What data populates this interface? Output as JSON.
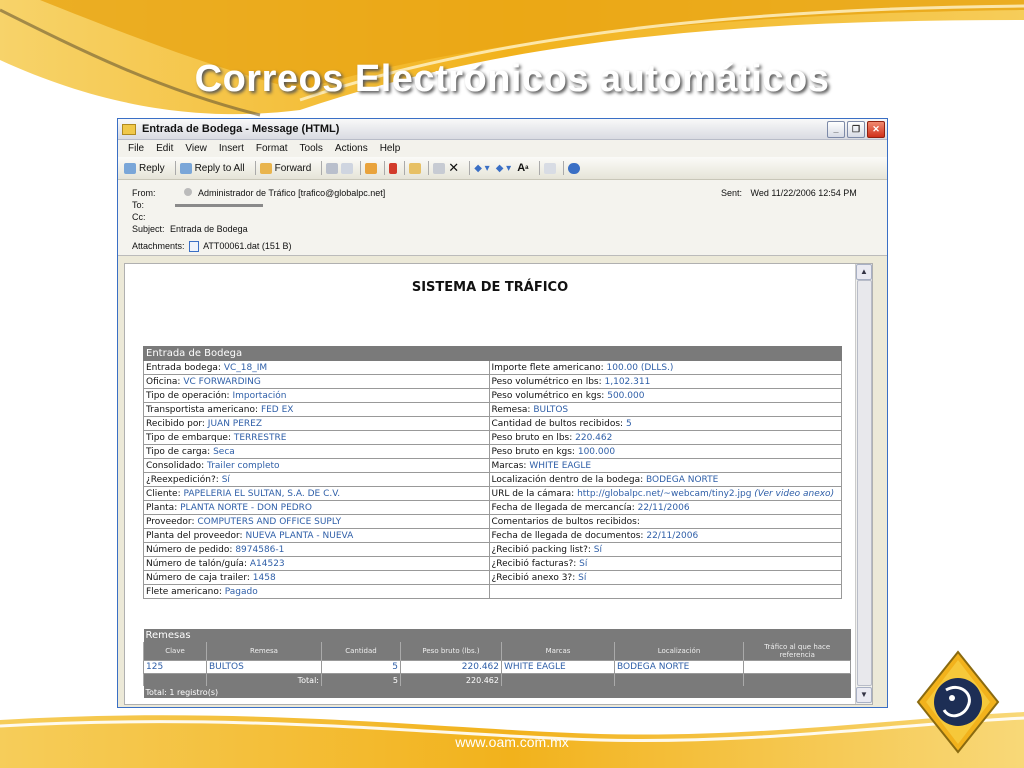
{
  "slide": {
    "title": "Correos Electrónicos automáticos",
    "footer_url": "www.oam.com.mx"
  },
  "window": {
    "title": "Entrada de Bodega - Message (HTML)",
    "menu": [
      "File",
      "Edit",
      "View",
      "Insert",
      "Format",
      "Tools",
      "Actions",
      "Help"
    ],
    "toolbar": {
      "reply": "Reply",
      "reply_all": "Reply to All",
      "forward": "Forward"
    }
  },
  "email": {
    "from_label": "From:",
    "from_value": "Administrador de Tráfico [trafico@globalpc.net]",
    "to_label": "To:",
    "cc_label": "Cc:",
    "subject_label": "Subject:",
    "subject_value": "Entrada de Bodega",
    "sent_label": "Sent:",
    "sent_value": "Wed 11/22/2006 12:54 PM",
    "attachments_label": "Attachments:",
    "attachment_value": "ATT00061.dat (151 B)"
  },
  "body": {
    "system_title": "SISTEMA DE TRÁFICO",
    "bodega_title": "Entrada de Bodega",
    "rows": [
      {
        "l_label": "Entrada bodega:",
        "l_value": "VC_18_IM",
        "r_label": "Importe flete americano:",
        "r_value": "100.00 (DLLS.)"
      },
      {
        "l_label": "Oficina:",
        "l_value": "VC FORWARDING",
        "r_label": "Peso volumétrico en lbs:",
        "r_value": "1,102.311"
      },
      {
        "l_label": "Tipo de operación:",
        "l_value": "Importación",
        "r_label": "Peso volumétrico en kgs:",
        "r_value": "500.000"
      },
      {
        "l_label": "Transportista americano:",
        "l_value": "FED EX",
        "r_label": "Remesa:",
        "r_value": "BULTOS"
      },
      {
        "l_label": "Recibido por:",
        "l_value": "JUAN PEREZ",
        "r_label": "Cantidad de bultos recibidos:",
        "r_value": "5"
      },
      {
        "l_label": "Tipo de embarque:",
        "l_value": "TERRESTRE",
        "r_label": "Peso bruto en lbs:",
        "r_value": "220.462"
      },
      {
        "l_label": "Tipo de carga:",
        "l_value": "Seca",
        "r_label": "Peso bruto en kgs:",
        "r_value": "100.000"
      },
      {
        "l_label": "Consolidado:",
        "l_value": "Trailer completo",
        "r_label": "Marcas:",
        "r_value": "WHITE EAGLE"
      },
      {
        "l_label": "¿Reexpedición?:",
        "l_value": "Sí",
        "r_label": "Localización dentro de la bodega:",
        "r_value": "BODEGA NORTE"
      },
      {
        "l_label": "Cliente:",
        "l_value": "PAPELERIA EL SULTAN, S.A. DE C.V.",
        "r_label": "URL de la cámara:",
        "r_value": "http://globalpc.net/~webcam/tiny2.jpg",
        "r_note": "(Ver video anexo)"
      },
      {
        "l_label": "Planta:",
        "l_value": "PLANTA NORTE - DON PEDRO",
        "r_label": "Fecha de llegada de mercancía:",
        "r_value": "22/11/2006"
      },
      {
        "l_label": "Proveedor:",
        "l_value": "COMPUTERS AND OFFICE SUPLY",
        "r_label": "Comentarios de bultos recibidos:",
        "r_value": ""
      },
      {
        "l_label": "Planta del proveedor:",
        "l_value": "NUEVA PLANTA - NUEVA",
        "r_label": "Fecha de llegada de documentos:",
        "r_value": "22/11/2006"
      },
      {
        "l_label": "Número de pedido:",
        "l_value": "8974586-1",
        "r_label": "¿Recibió packing list?:",
        "r_value": "Sí"
      },
      {
        "l_label": "Número de talón/guía:",
        "l_value": "A14523",
        "r_label": "¿Recibió facturas?:",
        "r_value": "Sí"
      },
      {
        "l_label": "Número de caja trailer:",
        "l_value": "1458",
        "r_label": "¿Recibió anexo 3?:",
        "r_value": "Sí"
      },
      {
        "l_label": "Flete americano:",
        "l_value": "Pagado",
        "r_label": "",
        "r_value": ""
      }
    ],
    "remesas": {
      "title": "Remesas",
      "columns": [
        "Clave",
        "Remesa",
        "Cantidad",
        "Peso bruto (lbs.)",
        "Marcas",
        "Localización",
        "Tráfico al que hace referencia"
      ],
      "row": [
        "125",
        "BULTOS",
        "5",
        "220.462",
        "WHITE EAGLE",
        "BODEGA NORTE",
        ""
      ],
      "total_label": "Total:",
      "total_cantidad": "5",
      "total_peso": "220.462",
      "footer": "Total: 1 registro(s)"
    }
  },
  "colors": {
    "value_blue": "#2f5fa8",
    "header_gray": "#7a7a7a",
    "accent_gold": "#f2b21c"
  }
}
